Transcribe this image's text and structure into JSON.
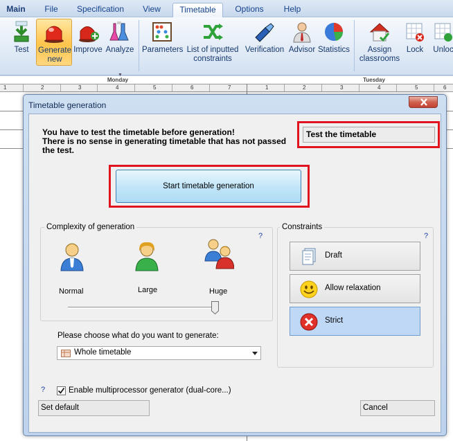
{
  "menu": {
    "tabs": [
      "Main",
      "File",
      "Specification",
      "View",
      "Timetable",
      "Options",
      "Help"
    ],
    "active": "Timetable"
  },
  "ribbon": {
    "buttons": [
      {
        "label": "Test",
        "icon": "download-arrow-icon"
      },
      {
        "label": "Generate new",
        "icon": "red-siren-icon",
        "selected": true
      },
      {
        "label": "Improve",
        "icon": "red-siren-plus-icon"
      },
      {
        "label": "Analyze",
        "icon": "flask-icon"
      },
      {
        "label": "Parameters",
        "icon": "abacus-icon"
      },
      {
        "label": "List of inputted constraints",
        "icon": "shuffle-arrows-icon"
      },
      {
        "label": "Verification",
        "icon": "flashlight-icon"
      },
      {
        "label": "Advisor",
        "icon": "advisor-person-icon"
      },
      {
        "label": "Statistics",
        "icon": "pie-chart-icon"
      },
      {
        "label": "Assign classrooms",
        "icon": "house-check-icon"
      },
      {
        "label": "Lock",
        "icon": "lock-table-icon"
      },
      {
        "label": "Unloc",
        "icon": "unlock-table-icon"
      }
    ]
  },
  "timetable": {
    "days": [
      "Monday",
      "Tuesday"
    ],
    "periods": [
      "1",
      "2",
      "3",
      "4",
      "5",
      "6",
      "7"
    ],
    "periods_partial_tuesday": [
      "1",
      "2",
      "3",
      "4",
      "5",
      "6"
    ]
  },
  "dialog": {
    "title": "Timetable generation",
    "warning_line1": "You have to test the timetable before generation!",
    "warning_line2": "There is no sense in generating timetable that has not passed the test.",
    "test_field": "Test the timetable",
    "start_button": "Start timetable generation",
    "complexity": {
      "label": "Complexity of generation",
      "help": "?",
      "levels": [
        "Normal",
        "Large",
        "Huge"
      ],
      "selected": "Huge"
    },
    "constraints": {
      "label": "Constraints",
      "help": "?",
      "options": [
        {
          "label": "Draft",
          "icon": "document-stack-icon"
        },
        {
          "label": "Allow relaxation",
          "icon": "smiley-icon"
        },
        {
          "label": "Strict",
          "icon": "red-x-icon",
          "selected": true
        }
      ]
    },
    "choose_label": "Please choose what do you want to generate:",
    "choose_value": "Whole timetable",
    "help_bottom": "?",
    "multiprocessor_label": "Enable multiprocessor generator (dual-core...)",
    "multiprocessor_checked": true,
    "set_default": "Set default",
    "cancel": "Cancel"
  },
  "colors": {
    "highlight_red": "#e0141e",
    "accent_blue": "#15428b",
    "selected_constraint": "#bfd8f6"
  }
}
